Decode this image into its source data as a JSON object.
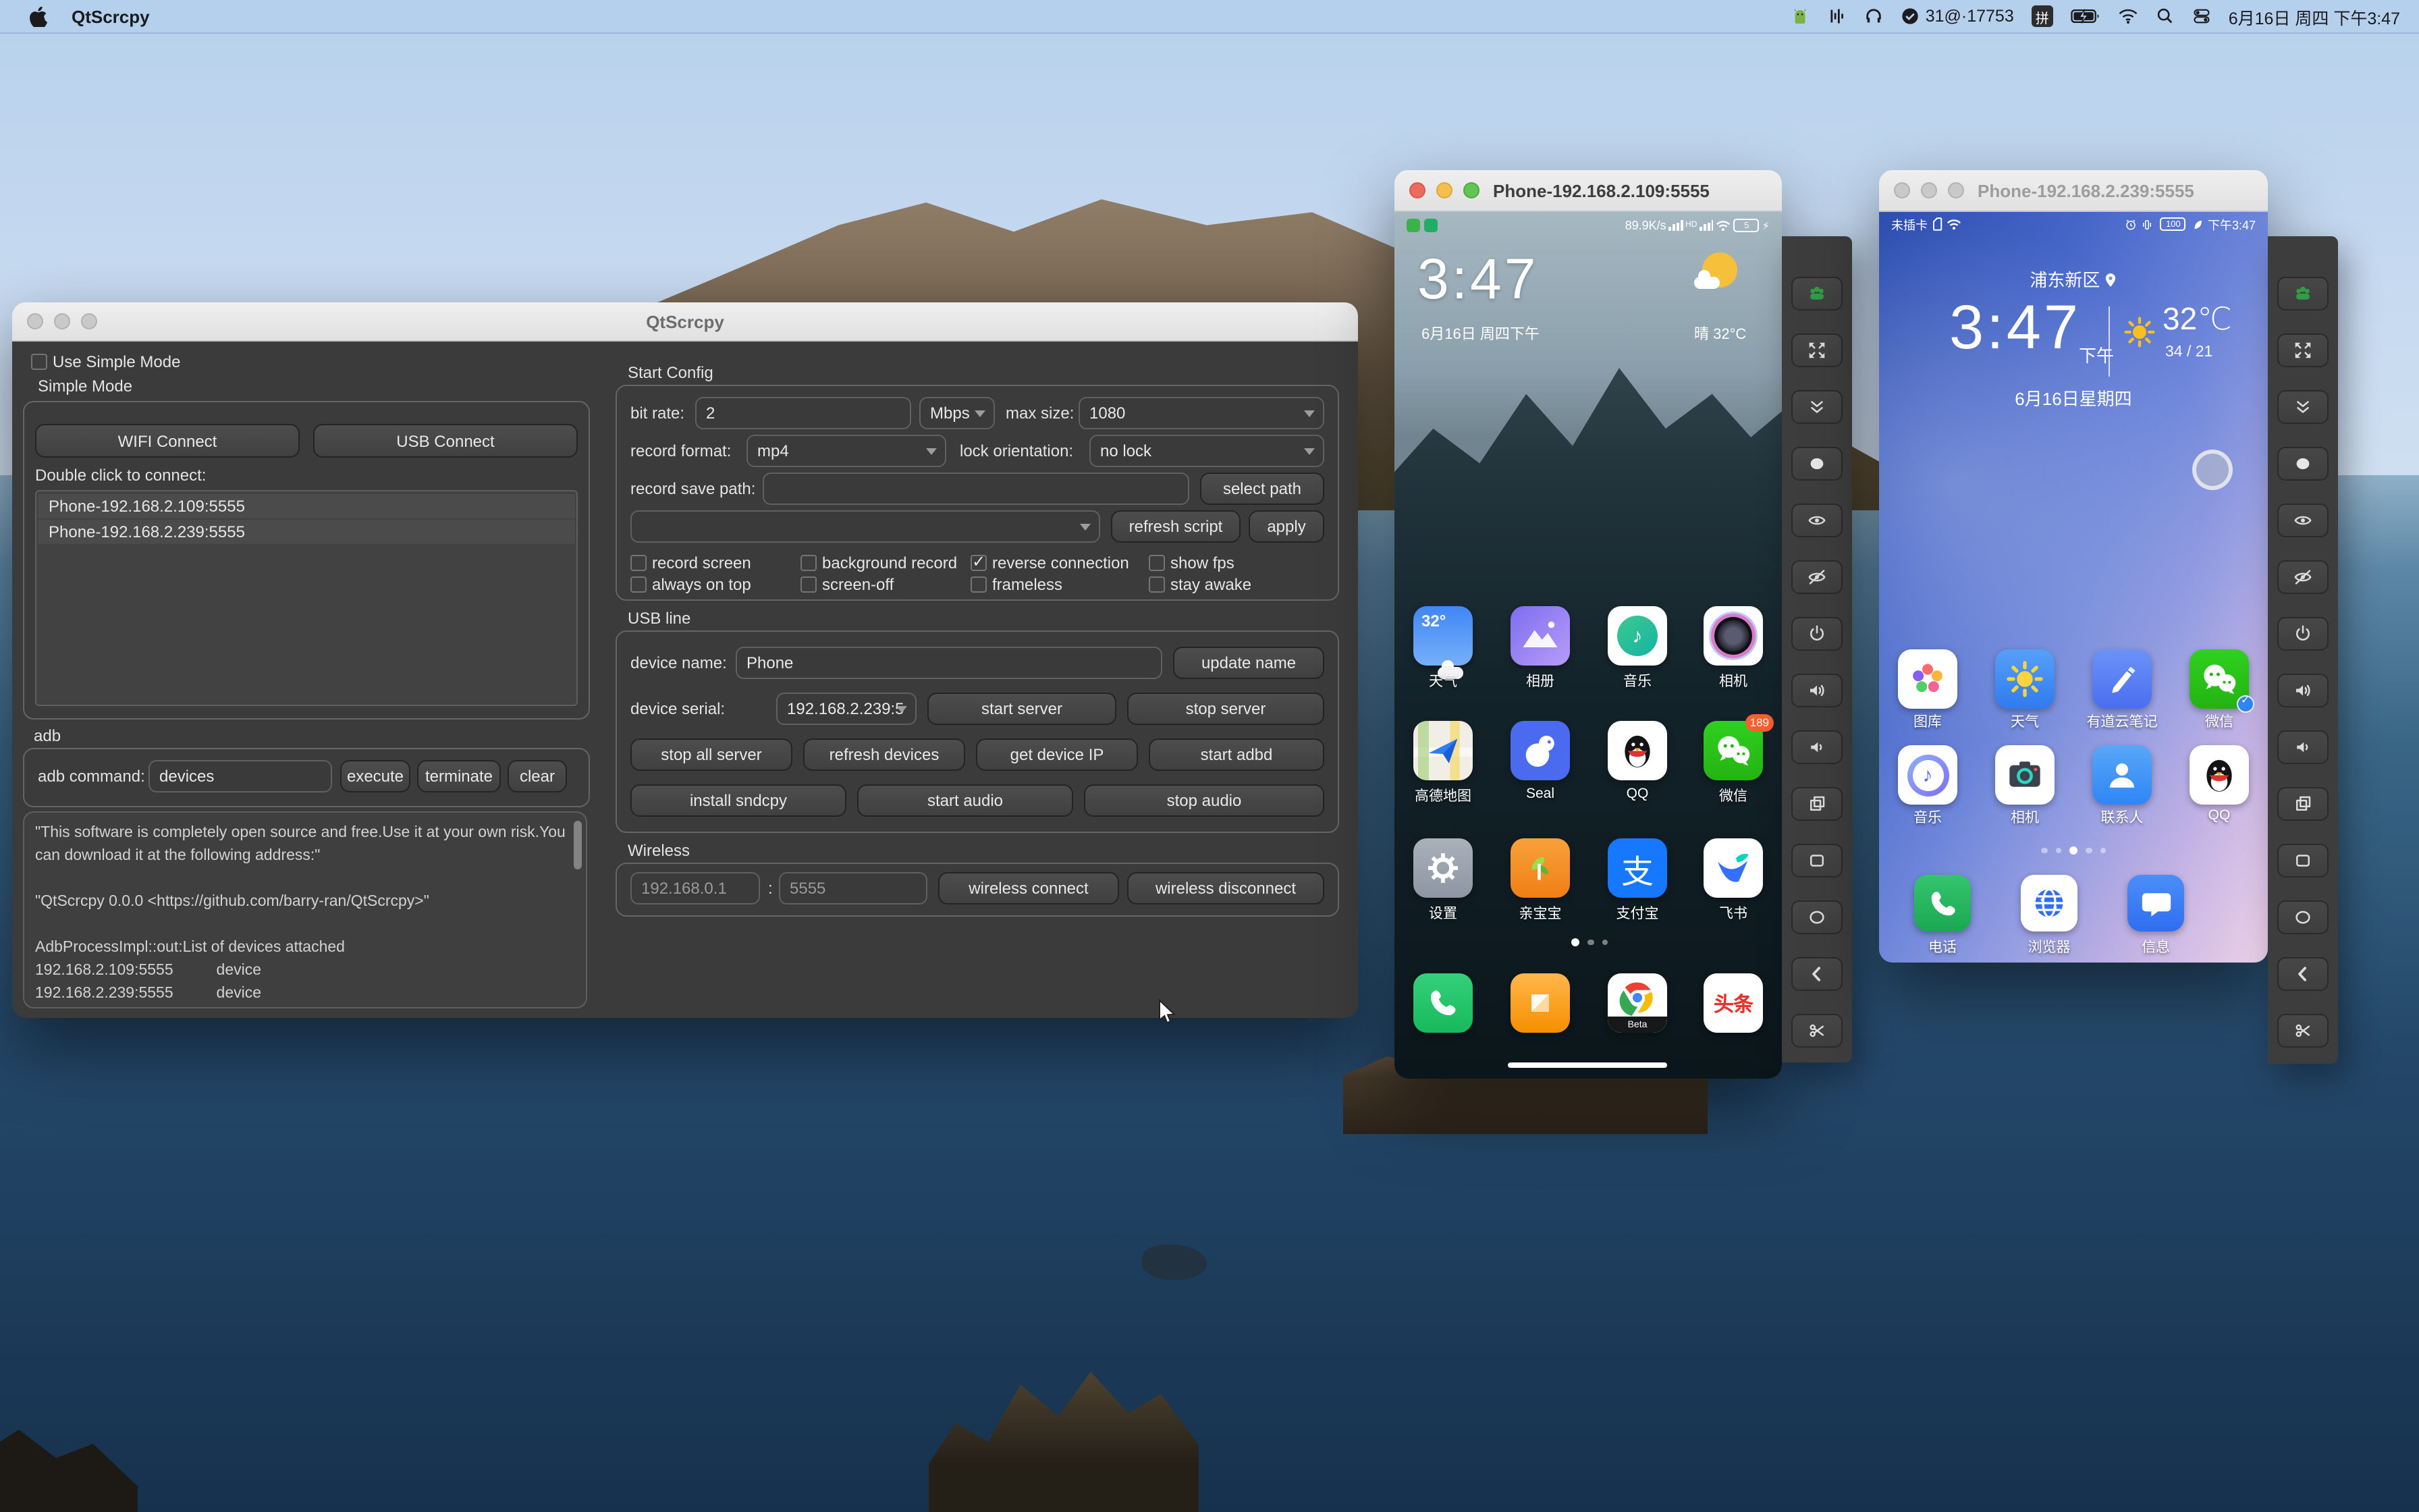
{
  "colors": {
    "accent_green": "#2f9e44",
    "qt_window_bg": "#3b3b3b",
    "menu_bar": "#b5cfec",
    "wechat_green": "#28c117",
    "alipay_blue": "#1677ff",
    "badge_orange": "#ff5f2e"
  },
  "menu_bar": {
    "app_name": "QtScrcpy",
    "status_count": "31@·17753",
    "ime_badge": "拼",
    "datetime": "6月16日 周四 下午3:47"
  },
  "main_window": {
    "title": "QtScrcpy",
    "left": {
      "use_simple_mode": "Use Simple Mode",
      "simple_mode": "Simple Mode",
      "wifi_connect": "WIFI Connect",
      "usb_connect": "USB Connect",
      "double_click": "Double click to connect:",
      "devices": [
        "Phone-192.168.2.109:5555",
        "Phone-192.168.2.239:5555"
      ],
      "adb_title": "adb",
      "adb_command_label": "adb command:",
      "adb_command_value": "devices",
      "execute": "execute",
      "terminate": "terminate",
      "clear": "clear",
      "console_lines": [
        "\"This software is completely open source and free.Use it at your own risk.You can download it at the following address:\"",
        "",
        "\"QtScrcpy 0.0.0 <https://github.com/barry-ran/QtScrcpy>\"",
        "",
        "AdbProcessImpl::out:List of devices attached",
        "192.168.2.109:5555          device",
        "192.168.2.239:5555          device"
      ]
    },
    "start_config": {
      "title": "Start Config",
      "bit_rate_label": "bit rate:",
      "bit_rate_value": "2",
      "bit_rate_unit": "Mbps",
      "max_size_label": "max size:",
      "max_size_value": "1080",
      "record_format_label": "record format:",
      "record_format_value": "mp4",
      "lock_orientation_label": "lock orientation:",
      "lock_orientation_value": "no lock",
      "record_save_path_label": "record save path:",
      "select_path": "select path",
      "refresh_script": "refresh script",
      "apply": "apply",
      "checkboxes_row1": [
        {
          "label": "record screen",
          "checked": false
        },
        {
          "label": "background record",
          "checked": false
        },
        {
          "label": "reverse connection",
          "checked": true
        },
        {
          "label": "show fps",
          "checked": false
        }
      ],
      "checkboxes_row2": [
        {
          "label": "always on top",
          "checked": false
        },
        {
          "label": "screen-off",
          "checked": false
        },
        {
          "label": "frameless",
          "checked": false
        },
        {
          "label": "stay awake",
          "checked": false
        }
      ]
    },
    "usb_line": {
      "title": "USB line",
      "device_name_label": "device name:",
      "device_name_value": "Phone",
      "update_name": "update name",
      "device_serial_label": "device serial:",
      "device_serial_value": "192.168.2.239:5",
      "start_server": "start server",
      "stop_server": "stop server",
      "stop_all_server": "stop all server",
      "refresh_devices": "refresh devices",
      "get_device_ip": "get device IP",
      "start_adbd": "start adbd",
      "install_sndcpy": "install sndcpy",
      "start_audio": "start audio",
      "stop_audio": "stop audio"
    },
    "wireless": {
      "title": "Wireless",
      "ip": "192.168.0.1",
      "colon": ":",
      "port": "5555",
      "connect": "wireless connect",
      "disconnect": "wireless disconnect"
    }
  },
  "phone1": {
    "title": "Phone-192.168.2.109:5555",
    "status_speed": "89.9K/s",
    "status_hd": "HD",
    "status_battery": "5",
    "clock": "3:47",
    "date": "6月16日 周四下午",
    "weather": "晴 32°C",
    "weather_badge": "32°",
    "apps": [
      {
        "label": "天气"
      },
      {
        "label": "相册"
      },
      {
        "label": "音乐"
      },
      {
        "label": "相机"
      },
      {
        "label": "高德地图"
      },
      {
        "label": "Seal"
      },
      {
        "label": "QQ"
      },
      {
        "label": "微信",
        "badge": "189"
      },
      {
        "label": "设置"
      },
      {
        "label": "亲宝宝"
      },
      {
        "label": "支付宝"
      },
      {
        "label": "飞书"
      }
    ],
    "alipay_glyph": "支",
    "dock_chrome_label": "Beta",
    "dock_toutiao": "头条"
  },
  "phone2": {
    "title": "Phone-192.168.2.239:5555",
    "status_left": "未插卡",
    "status_battery": "100",
    "status_time": "下午3:47",
    "location": "浦东新区",
    "clock": "3:47",
    "ampm": "下午",
    "temp": "32℃",
    "hilo": "34 / 21",
    "date": "6月16日星期四",
    "apps": [
      {
        "label": "图库"
      },
      {
        "label": "天气"
      },
      {
        "label": "有道云笔记"
      },
      {
        "label": "微信"
      },
      {
        "label": "音乐"
      },
      {
        "label": "相机"
      },
      {
        "label": "联系人"
      },
      {
        "label": "QQ"
      }
    ],
    "dock": [
      {
        "label": "电话"
      },
      {
        "label": "浏览器"
      },
      {
        "label": "信息"
      }
    ]
  },
  "music_note": "♪"
}
